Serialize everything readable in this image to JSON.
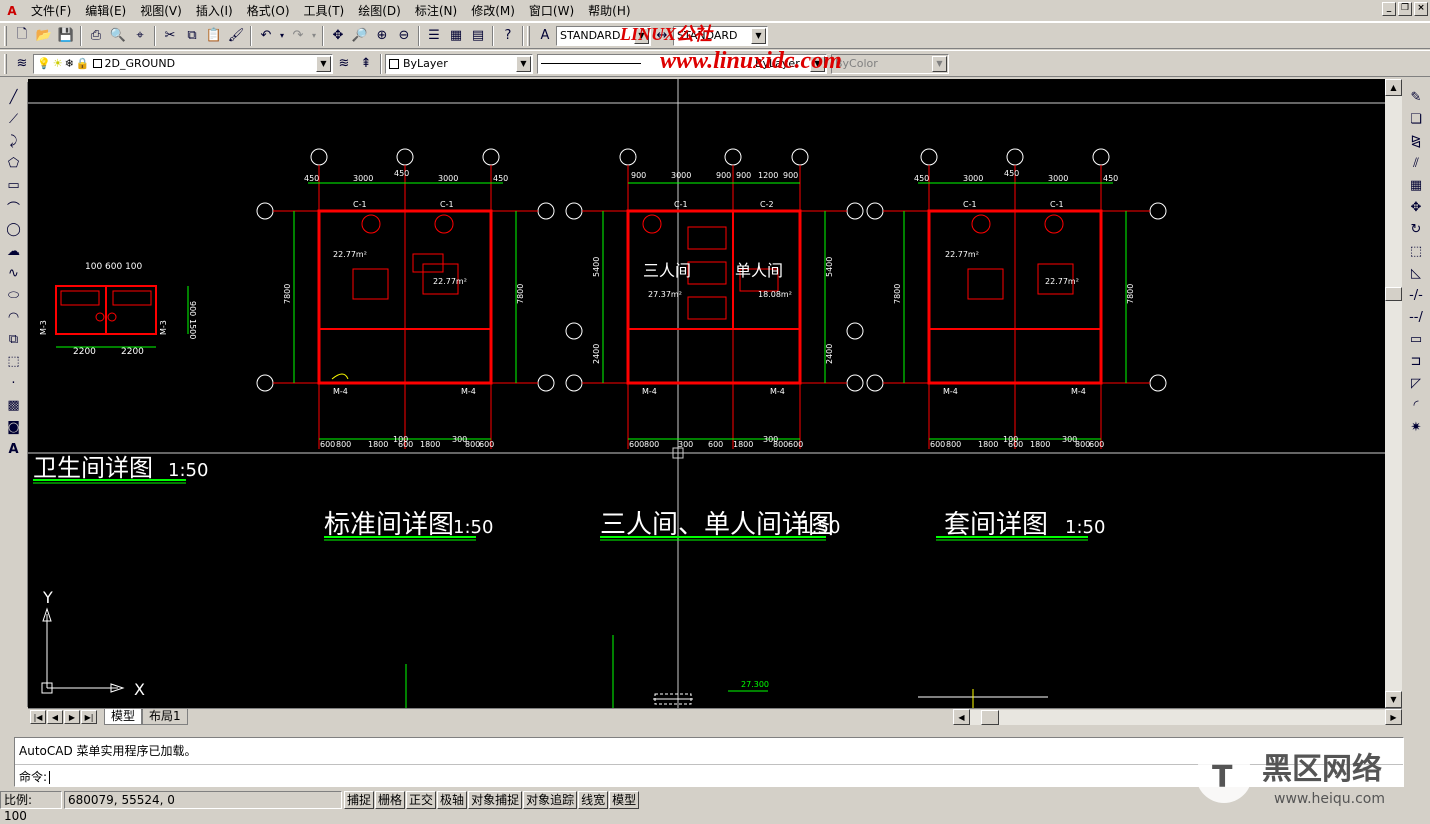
{
  "menu": {
    "items": [
      "文件(F)",
      "编辑(E)",
      "视图(V)",
      "插入(I)",
      "格式(O)",
      "工具(T)",
      "绘图(D)",
      "标注(N)",
      "修改(M)",
      "窗口(W)",
      "帮助(H)"
    ]
  },
  "toolbar1": {
    "text_style": "STANDARD",
    "dim_style": "STANDARD"
  },
  "toolbar2": {
    "layer": "2D_GROUND",
    "color": "ByLayer",
    "linetype": "ByLayer",
    "lineweight": "ByLayer",
    "plotstyle": "ByColor"
  },
  "watermark": {
    "top1": "LINUX公社",
    "top2": "www.linuxidc.com",
    "br_cn": "黑区网络",
    "br_url": "www.heiqu.com"
  },
  "drawing": {
    "titles": {
      "bath": "卫生间详图",
      "standard": "标准间详图",
      "triple_single": "三人间、单人间详图",
      "suite": "套间详图",
      "scale": "1:50"
    },
    "room_labels": {
      "triple": "三人间",
      "single": "单人间"
    },
    "areas": {
      "std": "22.77m²",
      "triple": "27.37m²",
      "single": "18.08m²"
    },
    "dims": {
      "d450": "450",
      "d3000": "3000",
      "d900": "900",
      "d1200": "1200",
      "d7800": "7800",
      "d5400": "5400",
      "d2400": "2400",
      "d2200": "2200",
      "d1500": "1500",
      "d1800": "1800",
      "d600": "600",
      "d800": "800",
      "d300": "300",
      "d100": "100",
      "bath_top": "100 600 100",
      "elev": "27.300"
    },
    "tags": {
      "c1": "C-1",
      "c2": "C-2",
      "m3": "M-3",
      "m4": "M-4"
    },
    "ucs": {
      "x": "X",
      "y": "Y"
    }
  },
  "tabs": {
    "model": "模型",
    "layout1": "布局1"
  },
  "command": {
    "line1": "AutoCAD 菜单实用程序已加载。",
    "prompt": "命令:"
  },
  "status": {
    "scale": "比例: 100",
    "coords": "680079, 55524, 0",
    "buttons": [
      "捕捉",
      "栅格",
      "正交",
      "极轴",
      "对象捕捉",
      "对象追踪",
      "线宽",
      "模型"
    ]
  },
  "colors": {
    "canvas": "#000000",
    "wall": "#ff0000",
    "dim": "#00ff00",
    "text": "#ffffff",
    "axis": "#ff0000",
    "furniture": "#ff0000",
    "door": "#ffff00"
  }
}
